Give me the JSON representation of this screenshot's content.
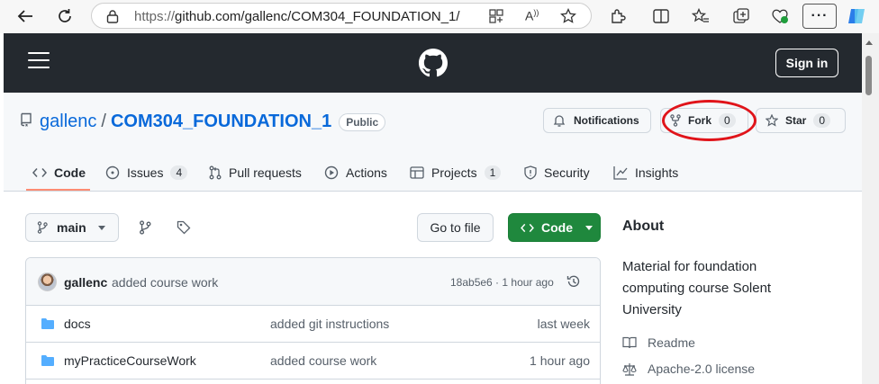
{
  "browser": {
    "url_prefix": "https://",
    "url_main": "github.com/gallenc/COM304_FOUNDATION_1/",
    "more_label": "···"
  },
  "header": {
    "signin_label": "Sign in"
  },
  "repo": {
    "owner": "gallenc",
    "separator": "/",
    "name": "COM304_FOUNDATION_1",
    "visibility": "Public",
    "notifications_label": "Notifications",
    "fork_label": "Fork",
    "fork_count": "0",
    "star_label": "Star",
    "star_count": "0"
  },
  "annotation": {
    "color": "#e0141a"
  },
  "tabs": [
    {
      "label": "Code",
      "icon": "code-icon"
    },
    {
      "label": "Issues",
      "count": "4",
      "icon": "issue-icon"
    },
    {
      "label": "Pull requests",
      "icon": "pull-request-icon"
    },
    {
      "label": "Actions",
      "icon": "play-icon"
    },
    {
      "label": "Projects",
      "count": "1",
      "icon": "table-icon"
    },
    {
      "label": "Security",
      "icon": "shield-icon"
    },
    {
      "label": "Insights",
      "icon": "graph-icon"
    }
  ],
  "toolbar": {
    "branch": "main",
    "goto_file": "Go to file",
    "code_button": "Code"
  },
  "commit": {
    "author": "gallenc",
    "message": "added course work",
    "meta": "18ab5e6 · 1 hour ago"
  },
  "files": [
    {
      "name": "docs",
      "message": "added git instructions",
      "age": "last week"
    },
    {
      "name": "myPracticeCourseWork",
      "message": "added course work",
      "age": "1 hour ago"
    }
  ],
  "about": {
    "heading": "About",
    "description": "Material for foundation computing course Solent University",
    "readme": "Readme",
    "license": "Apache-2.0 license"
  },
  "colors": {
    "accent": "#0969da",
    "code_button": "#1f883d",
    "header": "#24292f",
    "tab_underline": "#fd8c73"
  }
}
